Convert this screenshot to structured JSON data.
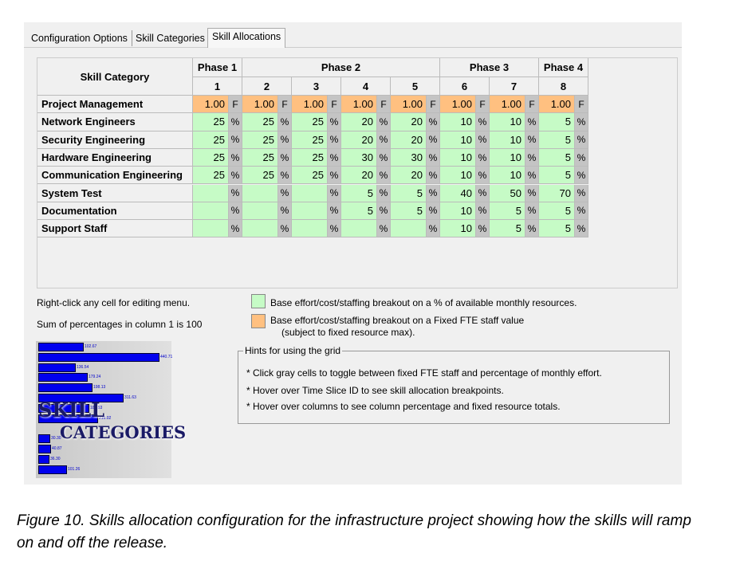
{
  "tabs": [
    {
      "label": "Configuration Options"
    },
    {
      "label": "Skill Categories"
    },
    {
      "label": "Skill Allocations",
      "active": true
    }
  ],
  "grid": {
    "category_header": "Skill Category",
    "phases": [
      {
        "label": "Phase 1",
        "cols": 1
      },
      {
        "label": "Phase 2",
        "cols": 4
      },
      {
        "label": "Phase 3",
        "cols": 2
      },
      {
        "label": "Phase 4",
        "cols": 1
      }
    ],
    "slices": [
      "1",
      "2",
      "3",
      "4",
      "5",
      "6",
      "7",
      "8"
    ],
    "rows": [
      {
        "label": "Project Management",
        "type": "F",
        "values": [
          "1.00",
          "1.00",
          "1.00",
          "1.00",
          "1.00",
          "1.00",
          "1.00",
          "1.00"
        ]
      },
      {
        "label": "Network Engineers",
        "type": "%",
        "values": [
          "25",
          "25",
          "25",
          "20",
          "20",
          "10",
          "10",
          "5"
        ]
      },
      {
        "label": "Security Engineering",
        "type": "%",
        "values": [
          "25",
          "25",
          "25",
          "20",
          "20",
          "10",
          "10",
          "5"
        ]
      },
      {
        "label": "Hardware Engineering",
        "type": "%",
        "values": [
          "25",
          "25",
          "25",
          "30",
          "30",
          "10",
          "10",
          "5"
        ]
      },
      {
        "label": "Communication Engineering",
        "type": "%",
        "values": [
          "25",
          "25",
          "25",
          "20",
          "20",
          "10",
          "10",
          "5"
        ]
      },
      {
        "label": "System Test",
        "type": "%",
        "values": [
          "",
          "",
          "",
          "5",
          "5",
          "40",
          "50",
          "70"
        ]
      },
      {
        "label": "Documentation",
        "type": "%",
        "values": [
          "",
          "",
          "",
          "5",
          "5",
          "10",
          "5",
          "5"
        ]
      },
      {
        "label": "Support Staff",
        "type": "%",
        "values": [
          "",
          "",
          "",
          "",
          "",
          "10",
          "5",
          "5"
        ]
      }
    ]
  },
  "colors": {
    "percent": "#c6fbc6",
    "fixed": "#ffc080",
    "toggle": "#c4c4c4"
  },
  "notes": {
    "edit": "Right-click any cell for editing menu.",
    "sum": "Sum of percentages in column 1 is 100"
  },
  "legend": {
    "percent": "Base effort/cost/staffing  breakout on a % of available monthly resources.",
    "fixed": "Base effort/cost/staffing breakout on a Fixed FTE staff value",
    "fixed2": "(subject to fixed resource max)."
  },
  "hints": {
    "title": "Hints for using the grid",
    "items": [
      "Click gray cells to toggle between fixed FTE staff and percentage of monthly effort.",
      "Hover over Time Slice ID to see skill allocation breakpoints.",
      "Hover over columns to see column percentage and fixed resource totals."
    ]
  },
  "logo": {
    "line1": "SKILL",
    "line2": "CATEGORIES",
    "bars": [
      "102.67",
      "440.71",
      "136.54",
      "179.24",
      "198.13",
      "311.63",
      "183.53",
      "216.02",
      "",
      "30.30",
      "40.87",
      "36.30",
      "101.26"
    ]
  },
  "caption": "Figure 10. Skills allocation configuration for the infrastructure project showing how the skills will ramp on and off the release."
}
